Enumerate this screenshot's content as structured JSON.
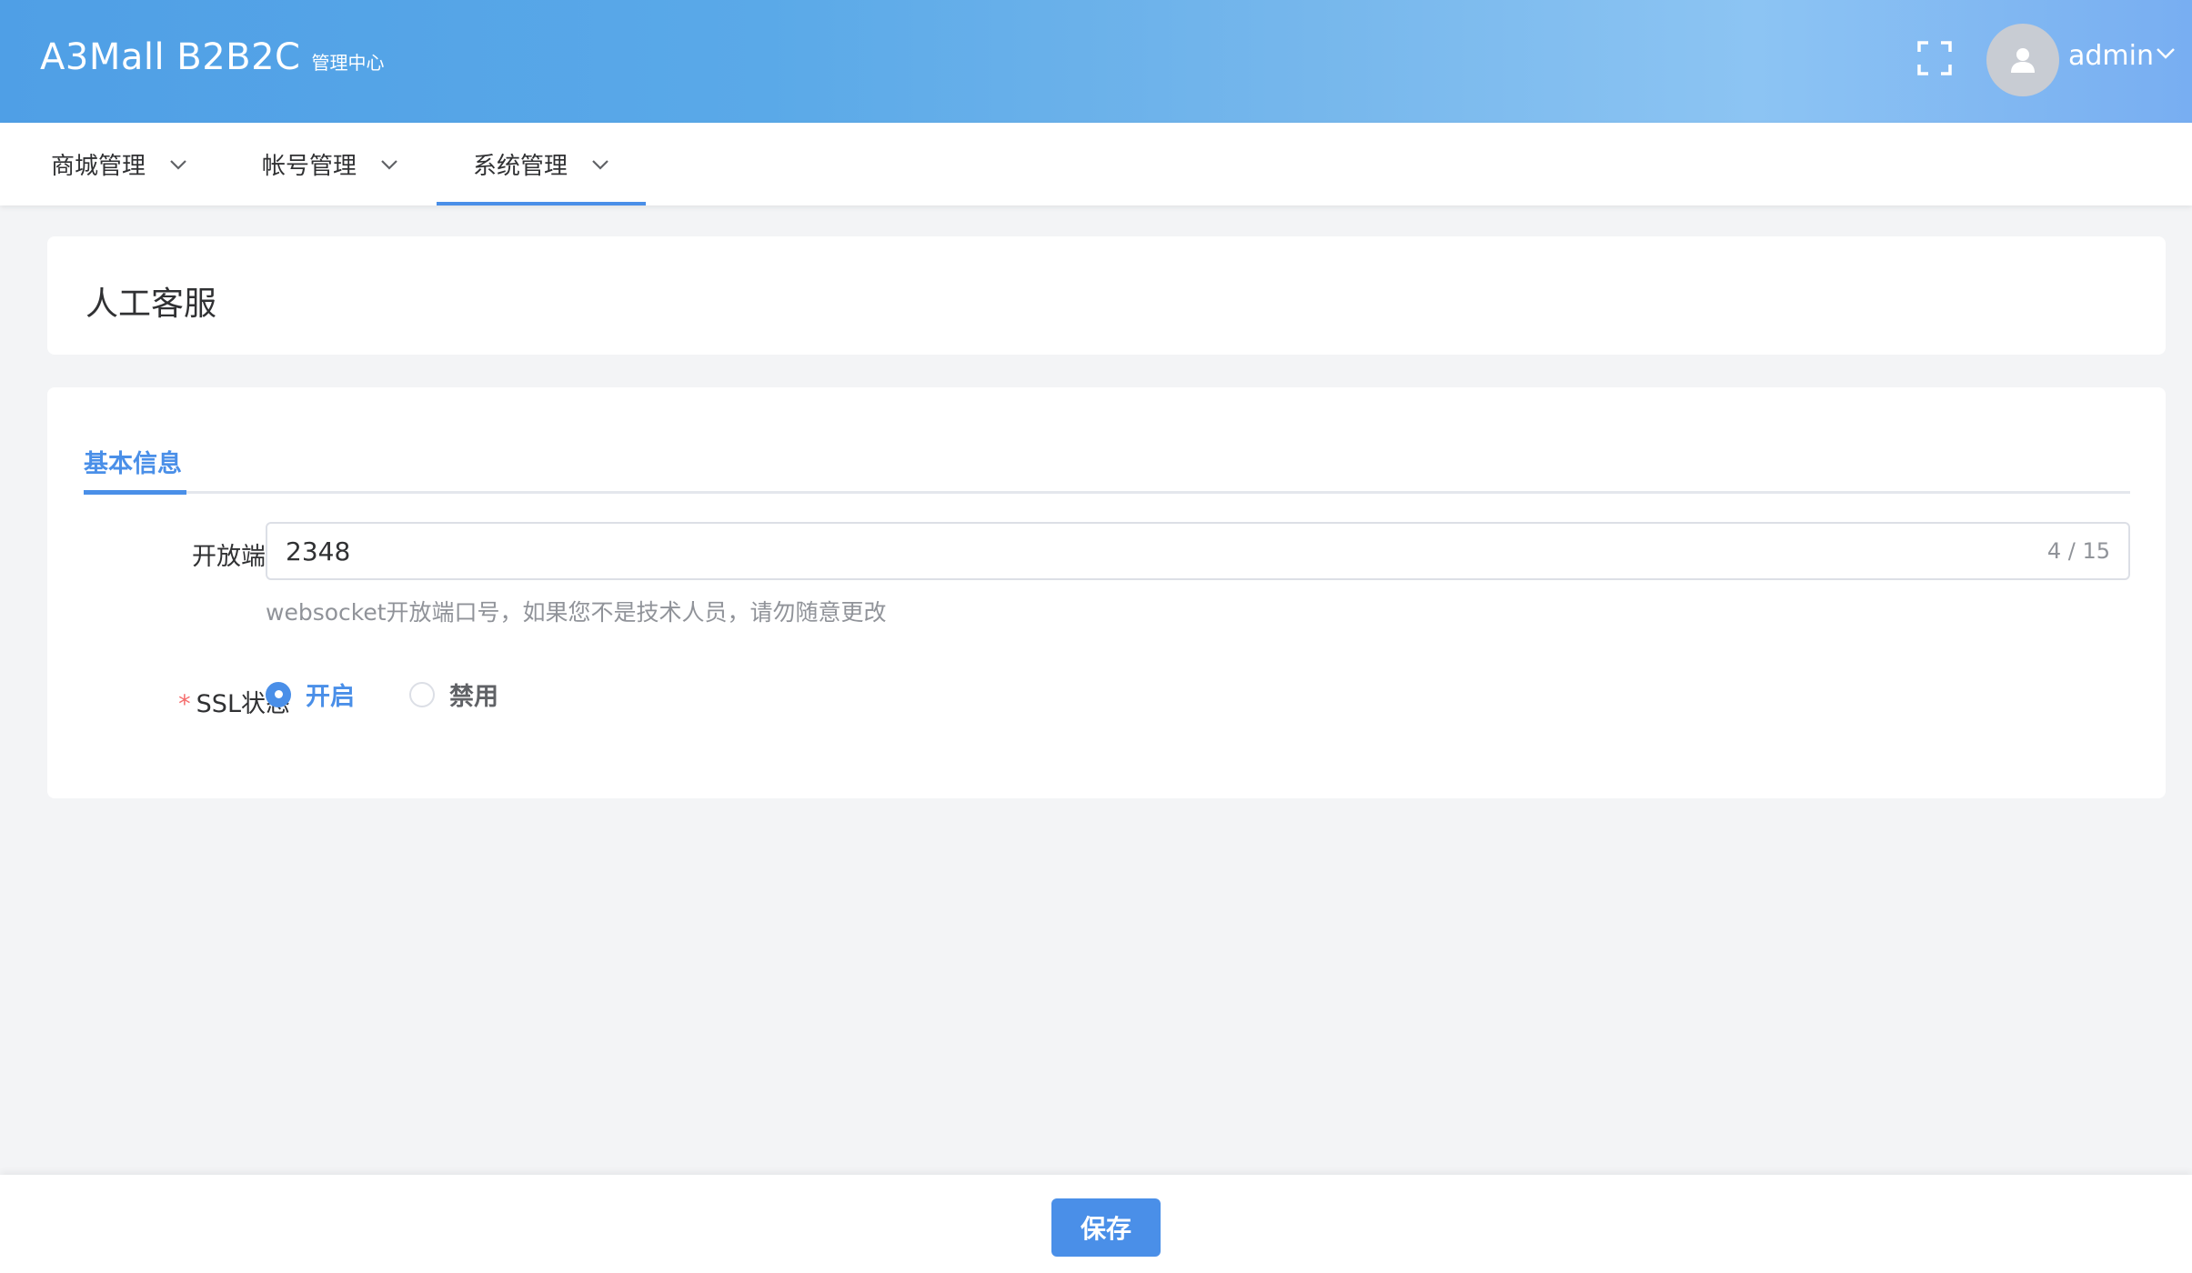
{
  "header": {
    "logo_main": "A3Mall B2B2C",
    "logo_sub": "管理中心",
    "user_name": "admin",
    "fullscreen_icon": "fullscreen-icon",
    "avatar_icon": "user-icon"
  },
  "nav": {
    "items": [
      {
        "label": "商城管理",
        "active": false
      },
      {
        "label": "帐号管理",
        "active": false
      },
      {
        "label": "系统管理",
        "active": true
      }
    ]
  },
  "page": {
    "title": "人工客服"
  },
  "form": {
    "tab_label": "基本信息",
    "port": {
      "label": "开放端口",
      "value": "2348",
      "counter": "4 / 15",
      "hint": "websocket开放端口号，如果您不是技术人员，请勿随意更改"
    },
    "ssl": {
      "required_mark": "*",
      "label": "SSL状态",
      "options": [
        {
          "label": "开启",
          "checked": true
        },
        {
          "label": "禁用",
          "checked": false
        }
      ]
    }
  },
  "footer": {
    "save_label": "保存"
  },
  "colors": {
    "accent": "#4a8fe8",
    "required": "#f56c6c"
  }
}
